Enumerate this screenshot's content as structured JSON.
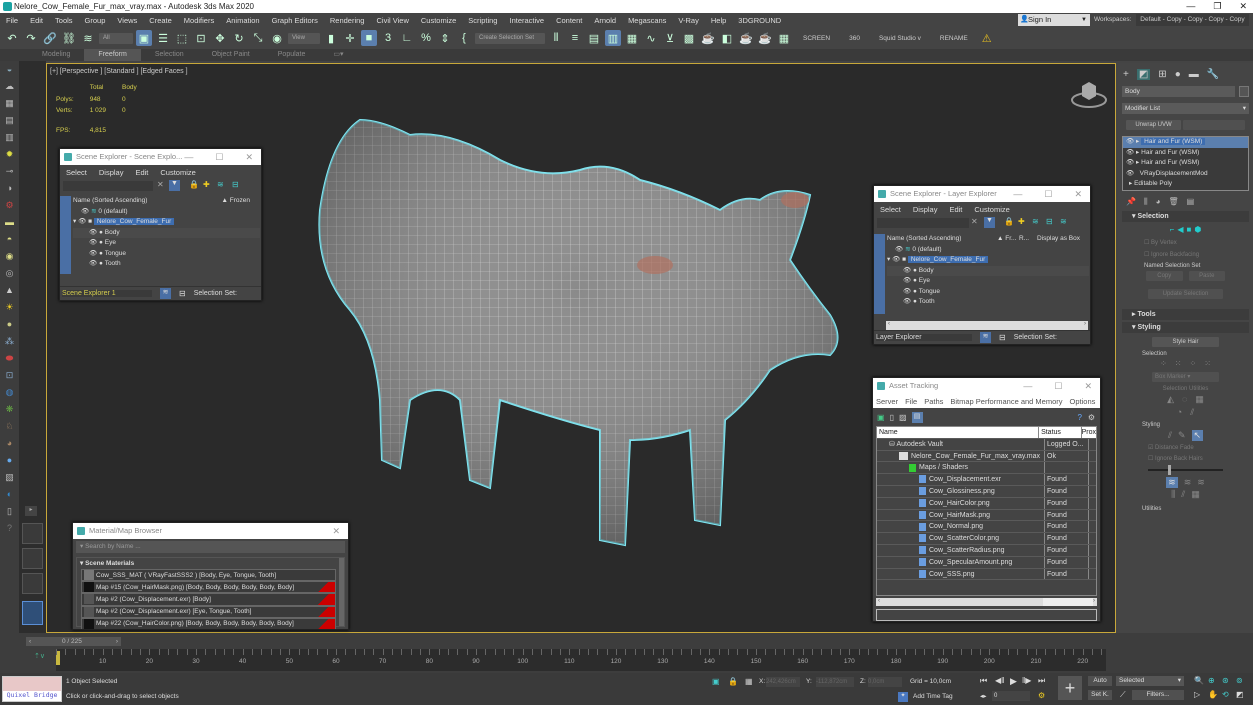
{
  "window": {
    "title": "Nelore_Cow_Female_Fur_max_vray.max - Autodesk 3ds Max 2020"
  },
  "menu": [
    "File",
    "Edit",
    "Tools",
    "Group",
    "Views",
    "Create",
    "Modifiers",
    "Animation",
    "Graph Editors",
    "Rendering",
    "Civil View",
    "Customize",
    "Scripting",
    "Interactive",
    "Content",
    "Arnold",
    "Megascans",
    "V-Ray",
    "Help",
    "3DGROUND"
  ],
  "account": {
    "sign_in": "Sign In",
    "workspaces_label": "Workspaces:",
    "workspace_value": "Default - Copy - Copy - Copy - Copy"
  },
  "toolbar": {
    "selection_filter": "All",
    "ref_coord": "View",
    "create_selection_set": "Create Selection Set",
    "screen": "SCREEN",
    "v360": "360",
    "squid": "Squid Studio v",
    "rename": "RENAME"
  },
  "ribbon_tabs": [
    {
      "label": "Modeling",
      "active": false
    },
    {
      "label": "Freeform",
      "active": true
    },
    {
      "label": "Selection",
      "active": false
    },
    {
      "label": "Object Paint",
      "active": false
    },
    {
      "label": "Populate",
      "active": false
    }
  ],
  "viewport": {
    "label": "[+] [Perspective ] [Standard ] [Edged Faces ]",
    "stats": {
      "col_total": "Total",
      "col_body": "Body",
      "polys_label": "Polys:",
      "polys_total": "948",
      "polys_body": "0",
      "verts_label": "Verts:",
      "verts_total": "1 029",
      "verts_body": "0",
      "fps_label": "FPS:",
      "fps": "4,815"
    }
  },
  "scene_explorer": {
    "title": "Scene Explorer - Scene Explo...",
    "menu": [
      "Select",
      "Display",
      "Edit",
      "Customize"
    ],
    "col_name": "Name (Sorted Ascending)",
    "col_frozen": "▲ Frozen",
    "rows": [
      {
        "label": "0 (default)"
      },
      {
        "label": "Nelore_Cow_Female_Fur"
      },
      {
        "label": "Body"
      },
      {
        "label": "Eye"
      },
      {
        "label": "Tongue"
      },
      {
        "label": "Tooth"
      }
    ],
    "footer_name": "Scene Explorer 1",
    "selection_set_label": "Selection Set:"
  },
  "layer_explorer": {
    "title": "Scene Explorer - Layer Explorer",
    "menu": [
      "Select",
      "Display",
      "Edit",
      "Customize"
    ],
    "col_name": "Name (Sorted Ascending)",
    "col_fr": "▲ Fr...",
    "col_r": "R...",
    "col_box": "Display as Box",
    "rows": [
      {
        "label": "0 (default)"
      },
      {
        "label": "Nelore_Cow_Female_Fur"
      },
      {
        "label": "Body"
      },
      {
        "label": "Eye"
      },
      {
        "label": "Tongue"
      },
      {
        "label": "Tooth"
      }
    ],
    "footer_name": "Layer Explorer",
    "selection_set_label": "Selection Set:"
  },
  "asset_tracking": {
    "title": "Asset Tracking",
    "menu": [
      "Server",
      "File",
      "Paths",
      "Bitmap Performance and Memory",
      "Options"
    ],
    "col_name": "Name",
    "col_status": "Status",
    "col_proxy": "Prox",
    "rows": [
      {
        "name": "Autodesk Vault",
        "status": "Logged O..."
      },
      {
        "name": "Nelore_Cow_Female_Fur_max_vray.max",
        "status": "Ok"
      },
      {
        "name": "Maps / Shaders",
        "status": ""
      },
      {
        "name": "Cow_Displacement.exr",
        "status": "Found"
      },
      {
        "name": "Cow_Glossiness.png",
        "status": "Found"
      },
      {
        "name": "Cow_HairColor.png",
        "status": "Found"
      },
      {
        "name": "Cow_HairMask.png",
        "status": "Found"
      },
      {
        "name": "Cow_Normal.png",
        "status": "Found"
      },
      {
        "name": "Cow_ScatterColor.png",
        "status": "Found"
      },
      {
        "name": "Cow_ScatterRadius.png",
        "status": "Found"
      },
      {
        "name": "Cow_SpecularAmount.png",
        "status": "Found"
      },
      {
        "name": "Cow_SSS.png",
        "status": "Found"
      }
    ]
  },
  "material_browser": {
    "title": "Material/Map Browser",
    "search_placeholder": "Search by Name ...",
    "section": "Scene Materials",
    "items": [
      "Cow_SSS_MAT  ( VRayFastSSS2 )  [Body, Eye, Tongue, Tooth]",
      "Map #15 (Cow_HairMask.png)  [Body, Body, Body, Body, Body, Body]",
      "Map #2 (Cow_Displacement.exr)  [Body]",
      "Map #2 (Cow_Displacement.exr)  [Eye, Tongue, Tooth]",
      "Map #22 (Cow_HairColor.png)  [Body, Body, Body, Body, Body, Body]"
    ]
  },
  "command_panel": {
    "object_name": "Body",
    "modifier_list": "Modifier List",
    "unwrap_btn": "Unwrap UVW",
    "stack": [
      {
        "label": "Hair and Fur (WSM)",
        "selected": true
      },
      {
        "label": "Hair and Fur (WSM)",
        "selected": false
      },
      {
        "label": "Hair and Fur (WSM)",
        "selected": false
      },
      {
        "label": "VRayDisplacementMod",
        "selected": false
      },
      {
        "label": "Editable Poly",
        "selected": false
      }
    ],
    "rollout_selection": "Selection",
    "by_vertex": "By Vertex",
    "ignore_backfacing": "Ignore Backfacing",
    "named_sel_set": "Named Selection Set",
    "copy": "Copy",
    "paste": "Paste",
    "update_selection": "Update Selection",
    "rollout_tools": "Tools",
    "rollout_styling": "Styling",
    "style_hair": "Style Hair",
    "sub_selection": "Selection",
    "box_marker": "Box Marker",
    "selection_utilities": "Selection Utilities",
    "sub_styling": "Styling",
    "distance_fade": "Distance Fade",
    "ignore_back_hairs": "Ignore Back Hairs",
    "utilities": "Utilities"
  },
  "timeline": {
    "frame_counter": "0 / 225",
    "ticks": [
      "10",
      "20",
      "30",
      "40",
      "50",
      "60",
      "70",
      "80",
      "90",
      "100",
      "110",
      "120",
      "130",
      "140",
      "150",
      "160",
      "170",
      "180",
      "190",
      "200",
      "210",
      "220"
    ]
  },
  "status": {
    "quixel": "Quixel Bridge",
    "selected": "1 Object Selected",
    "prompt": "Click or click-and-drag to select objects",
    "x_label": "X:",
    "x_value": "242,426cm",
    "y_label": "Y:",
    "y_value": "-112,872cm",
    "z_label": "Z:",
    "z_value": "0,0cm",
    "grid": "Grid = 10,0cm",
    "add_time_tag": "Add Time Tag",
    "frame_value": "0",
    "auto": "Auto",
    "set_k": "Set K.",
    "key_filter": "Selected",
    "filters": "Filters..."
  }
}
